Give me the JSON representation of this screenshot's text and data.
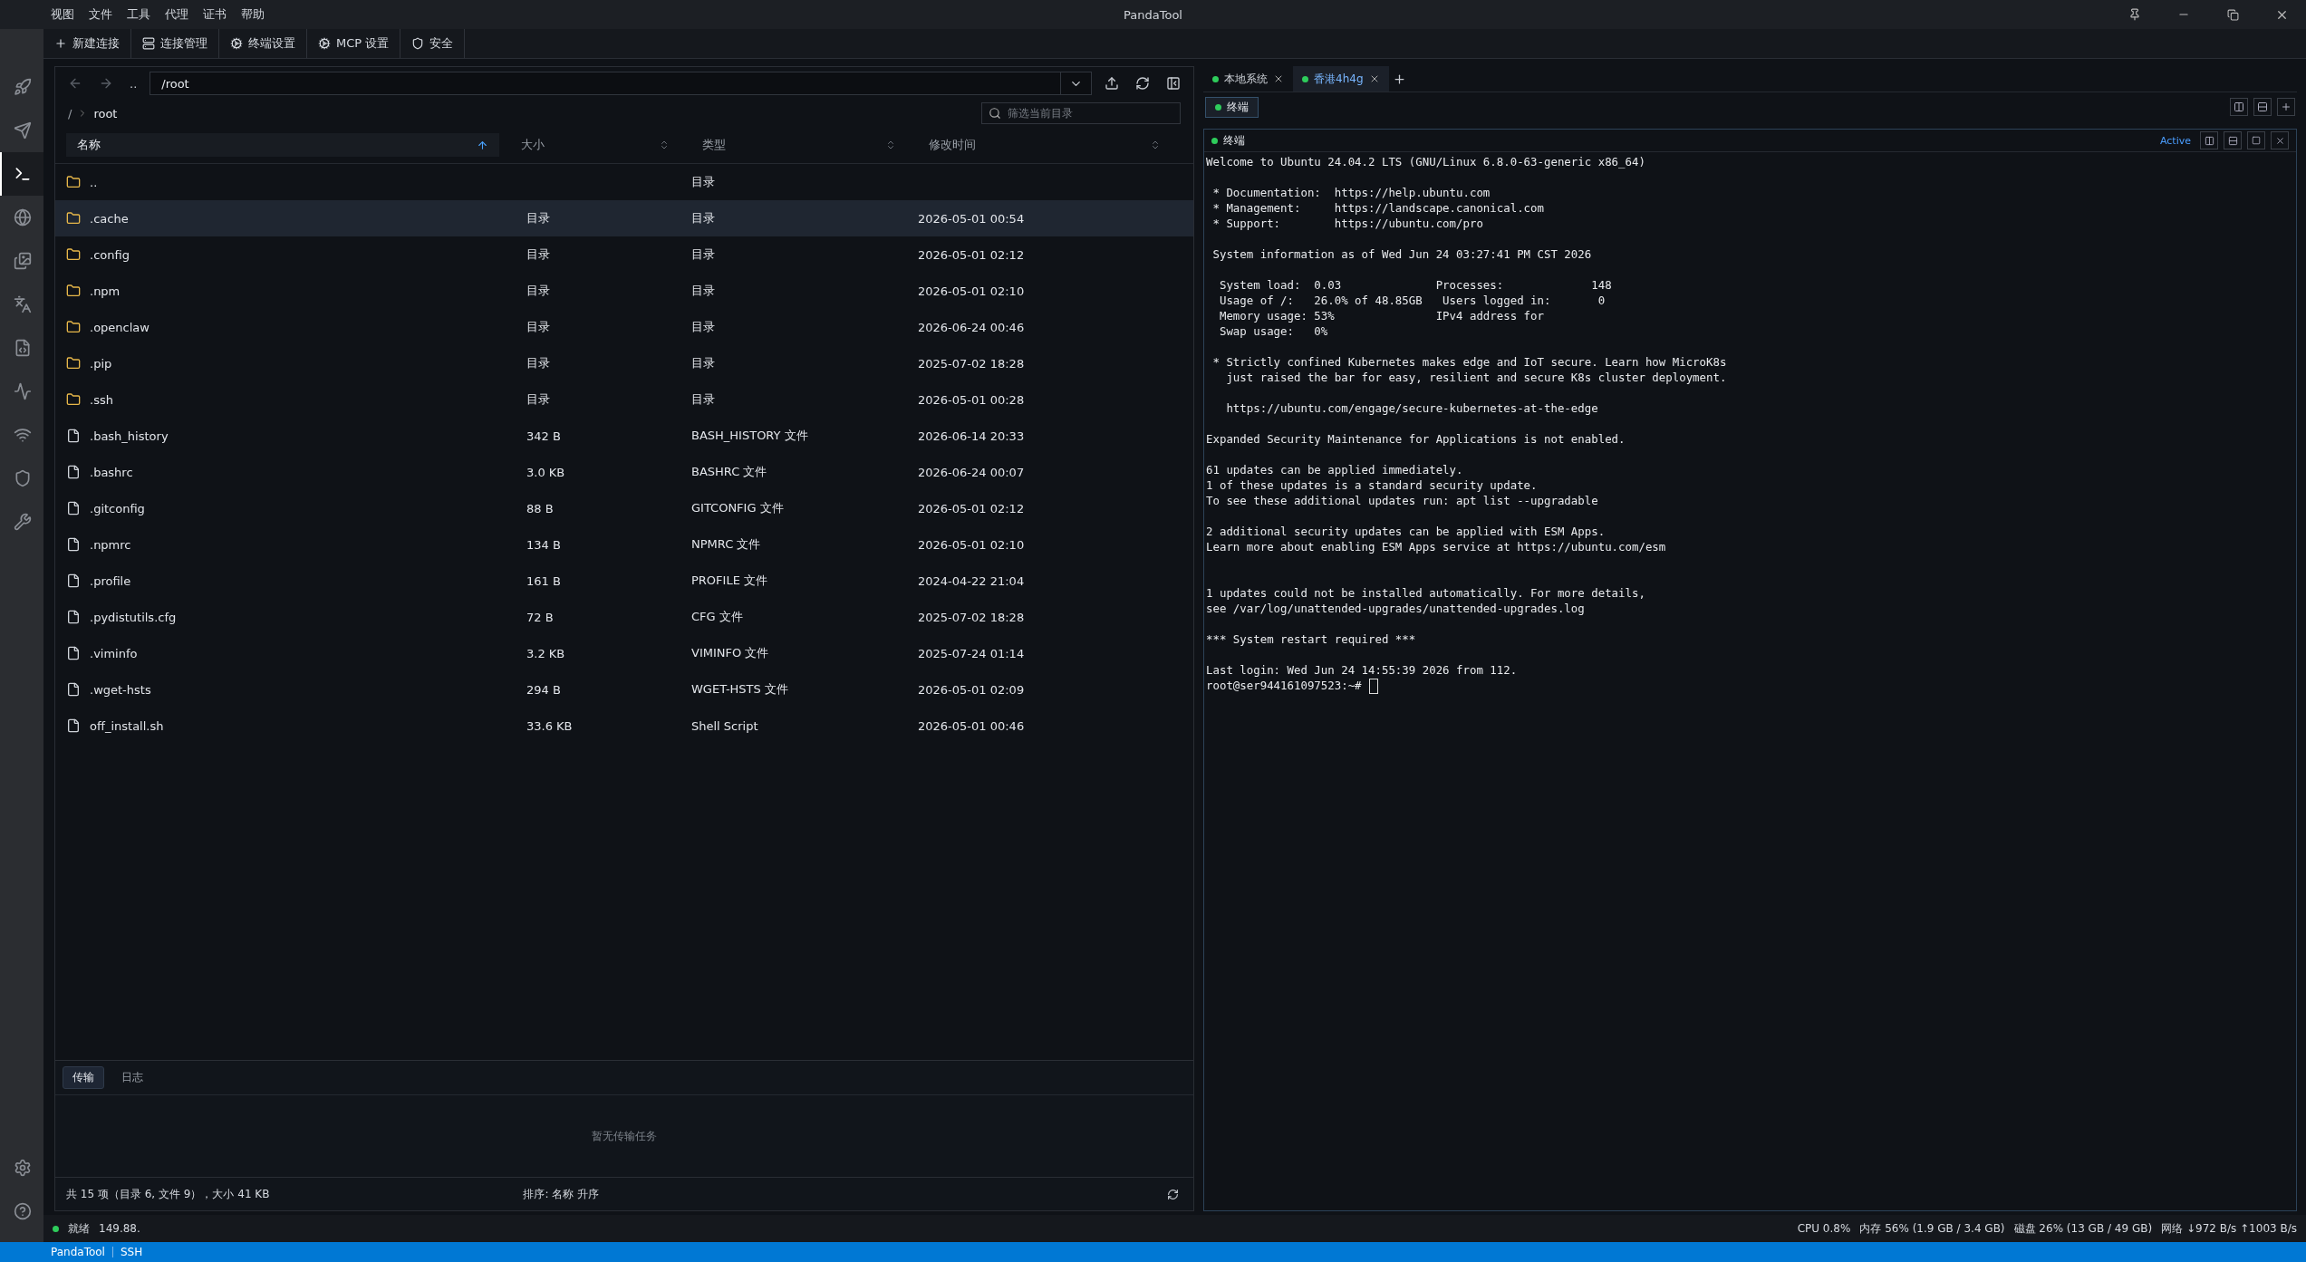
{
  "window": {
    "title": "PandaTool",
    "menu": [
      "视图",
      "文件",
      "工具",
      "代理",
      "证书",
      "帮助"
    ]
  },
  "toolbar": [
    "新建连接",
    "连接管理",
    "终端设置",
    "MCP 设置",
    "安全"
  ],
  "sidebar": {
    "items": [
      {
        "selected": false
      },
      {
        "selected": false
      },
      {
        "selected": true
      },
      {
        "selected": false
      },
      {
        "selected": false
      },
      {
        "selected": false
      },
      {
        "selected": false
      },
      {
        "selected": false
      },
      {
        "selected": false
      },
      {
        "selected": false
      },
      {
        "selected": false
      }
    ]
  },
  "files": {
    "up": "..",
    "path": "/root",
    "breadcrumb": [
      "/",
      "root"
    ],
    "filter_placeholder": "筛选当前目录",
    "columns": [
      {
        "label": "名称",
        "sorted": true
      },
      {
        "label": "大小",
        "sorted": false
      },
      {
        "label": "类型",
        "sorted": false
      },
      {
        "label": "修改时间",
        "sorted": false
      }
    ],
    "rows": [
      {
        "kind": "folder",
        "name": "..",
        "type": "目录",
        "selected": false
      },
      {
        "kind": "folder",
        "name": ".cache",
        "size": "目录",
        "type": "目录",
        "modified": "2026-05-01 00:54",
        "selected": true
      },
      {
        "kind": "folder",
        "name": ".config",
        "size": "目录",
        "type": "目录",
        "modified": "2026-05-01 02:12",
        "selected": false
      },
      {
        "kind": "folder",
        "name": ".npm",
        "size": "目录",
        "type": "目录",
        "modified": "2026-05-01 02:10",
        "selected": false
      },
      {
        "kind": "folder",
        "name": ".openclaw",
        "size": "目录",
        "type": "目录",
        "modified": "2026-06-24 00:46",
        "selected": false
      },
      {
        "kind": "folder",
        "name": ".pip",
        "size": "目录",
        "type": "目录",
        "modified": "2025-07-02 18:28",
        "selected": false
      },
      {
        "kind": "folder",
        "name": ".ssh",
        "size": "目录",
        "type": "目录",
        "modified": "2026-05-01 00:28",
        "selected": false
      },
      {
        "kind": "file",
        "name": ".bash_history",
        "size": "342 B",
        "type": "BASH_HISTORY 文件",
        "modified": "2026-06-14 20:33",
        "selected": false
      },
      {
        "kind": "file",
        "name": ".bashrc",
        "size": "3.0 KB",
        "type": "BASHRC 文件",
        "modified": "2026-06-24 00:07",
        "selected": false
      },
      {
        "kind": "file",
        "name": ".gitconfig",
        "size": "88 B",
        "type": "GITCONFIG 文件",
        "modified": "2026-05-01 02:12",
        "selected": false
      },
      {
        "kind": "file",
        "name": ".npmrc",
        "size": "134 B",
        "type": "NPMRC 文件",
        "modified": "2026-05-01 02:10",
        "selected": false
      },
      {
        "kind": "file",
        "name": ".profile",
        "size": "161 B",
        "type": "PROFILE 文件",
        "modified": "2024-04-22 21:04",
        "selected": false
      },
      {
        "kind": "file",
        "name": ".pydistutils.cfg",
        "size": "72 B",
        "type": "CFG 文件",
        "modified": "2025-07-02 18:28",
        "selected": false
      },
      {
        "kind": "file",
        "name": ".viminfo",
        "size": "3.2 KB",
        "type": "VIMINFO 文件",
        "modified": "2025-07-24 01:14",
        "selected": false
      },
      {
        "kind": "file",
        "name": ".wget-hsts",
        "size": "294 B",
        "type": "WGET-HSTS 文件",
        "modified": "2026-05-01 02:09",
        "selected": false
      },
      {
        "kind": "file",
        "name": "off_install.sh",
        "size": "33.6 KB",
        "type": "Shell Script",
        "modified": "2026-05-01 00:46",
        "selected": false
      }
    ],
    "transfer_tabs": [
      {
        "label": "传输",
        "selected": true
      },
      {
        "label": "日志",
        "selected": false
      }
    ],
    "transfer_empty": "暂无传输任务",
    "summary": "共 15 项（目录 6, 文件 9），大小 41 KB",
    "sort_info": "排序: 名称 升序"
  },
  "terminal": {
    "tabs": [
      {
        "label": "本地系统",
        "selected": false
      },
      {
        "label": "香港4h4g",
        "selected": true
      }
    ],
    "sub_tabs": [
      {
        "label": "终端",
        "selected": true
      }
    ],
    "pane_title": "终端",
    "pane_state": "Active",
    "blocks": [
      {
        "kind": "normal",
        "lines": [
          "Welcome to Ubuntu 24.04.2 LTS (GNU/Linux 6.8.0-63-generic x86_64)"
        ]
      },
      {
        "kind": "normal",
        "lines": [
          " * Documentation:  https://help.ubuntu.com",
          " * Management:     https://landscape.canonical.com",
          " * Support:        https://ubuntu.com/pro"
        ]
      },
      {
        "kind": "normal",
        "lines": [
          " System information as of Wed Jun 24 03:27:41 PM CST 2026"
        ]
      },
      {
        "kind": "normal",
        "lines": [
          "  System load:  0.03              Processes:             148",
          "  Usage of /:   26.0% of 48.85GB   Users logged in:       0",
          "  Memory usage: 53%               IPv4 address for",
          "  Swap usage:   0%"
        ]
      },
      {
        "kind": "normal",
        "lines": [
          " * Strictly confined Kubernetes makes edge and IoT secure. Learn how MicroK8s",
          "   just raised the bar for easy, resilient and secure K8s cluster deployment."
        ]
      },
      {
        "kind": "normal",
        "lines": [
          "   https://ubuntu.com/engage/secure-kubernetes-at-the-edge"
        ]
      },
      {
        "kind": "normal",
        "lines": [
          "Expanded Security Maintenance for Applications is not enabled."
        ]
      },
      {
        "kind": "normal",
        "lines": [
          "61 updates can be applied immediately.",
          "1 of these updates is a standard security update.",
          "To see these additional updates run: apt list --upgradable"
        ]
      },
      {
        "kind": "normal",
        "lines": [
          "2 additional security updates can be applied with ESM Apps.",
          "Learn more about enabling ESM Apps service at https://ubuntu.com/esm"
        ]
      },
      {
        "kind": "wide",
        "lines": [
          "1 updates could not be installed automatically. For more details,",
          "see /var/log/unattended-upgrades/unattended-upgrades.log"
        ]
      },
      {
        "kind": "normal",
        "lines": [
          "*** System restart required ***"
        ]
      },
      {
        "kind": "normal",
        "lines": [
          "Last login: Wed Jun 24 14:55:39 2026 from 112."
        ]
      }
    ],
    "prompt": "root@ser944161097523:~#"
  },
  "status": {
    "state": "就绪",
    "address": "149.88.",
    "cpu": "CPU 0.8%",
    "memory": "内存 56% (1.9 GB / 3.4 GB)",
    "disk": "磁盘 26% (13 GB / 49 GB)",
    "network": "网络 ↓972 B/s ↑1003 B/s"
  },
  "bottom_bar": [
    "PandaTool",
    "SSH"
  ]
}
